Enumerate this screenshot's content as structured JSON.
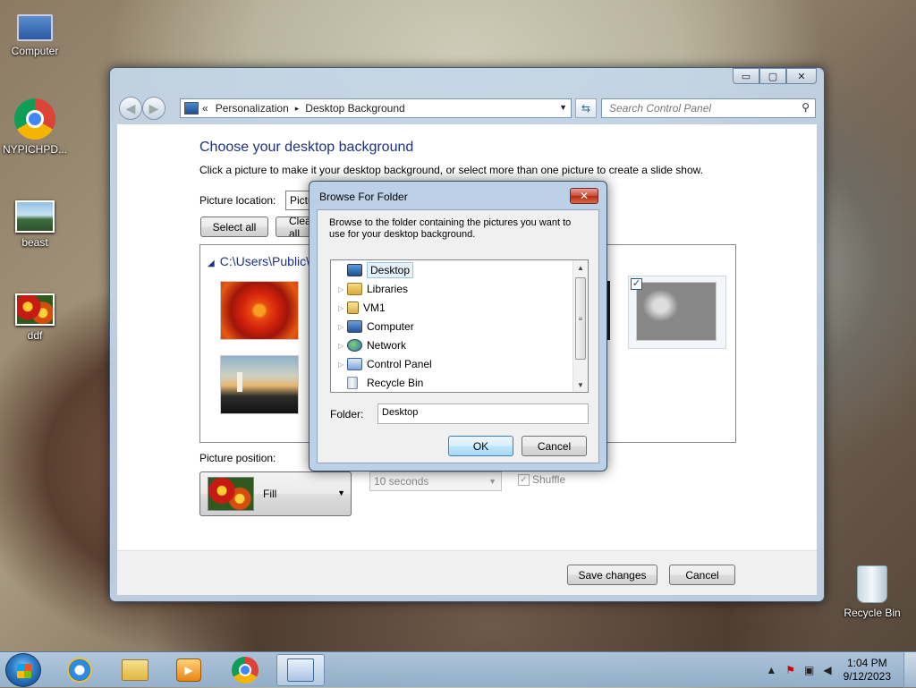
{
  "desktop": {
    "icons": [
      {
        "label": "Computer"
      },
      {
        "label": "NYPICHPD..."
      },
      {
        "label": "beast"
      },
      {
        "label": "ddf"
      },
      {
        "label": "Recycle Bin"
      }
    ]
  },
  "window": {
    "caption_buttons": {
      "minimize": "▭",
      "maximize": "▢",
      "close": "✕"
    },
    "nav": {
      "back": "◀",
      "forward": "▶"
    },
    "breadcrumb": {
      "overflow": "«",
      "items": [
        "Personalization",
        "Desktop Background"
      ],
      "separator": "▸"
    },
    "search_placeholder": "Search Control Panel",
    "heading": "Choose your desktop background",
    "subtitle": "Click a picture to make it your desktop background, or select more than one picture to create a slide show.",
    "picture_location_label": "Picture location:",
    "picture_location_value": "Pictures Library",
    "select_all_label": "Select all",
    "clear_all_label": "Clear all",
    "folder_path": "C:\\Users\\Public\\",
    "picture_position_label": "Picture position:",
    "picture_position_value": "Fill",
    "interval_value": "10 seconds",
    "shuffle_label": "Shuffle",
    "save_changes_label": "Save changes",
    "cancel_label": "Cancel"
  },
  "dialog": {
    "title": "Browse For Folder",
    "close_label": "✕",
    "description": "Browse to the folder containing the pictures you want to use for your desktop background.",
    "tree": [
      {
        "label": "Desktop",
        "selected": true
      },
      {
        "label": "Libraries"
      },
      {
        "label": "VM1"
      },
      {
        "label": "Computer"
      },
      {
        "label": "Network"
      },
      {
        "label": "Control Panel"
      },
      {
        "label": "Recycle Bin"
      }
    ],
    "folder_label": "Folder:",
    "folder_value": "Desktop",
    "ok_label": "OK",
    "cancel_label": "Cancel"
  },
  "taskbar": {
    "time": "1:04 PM",
    "date": "9/12/2023"
  }
}
